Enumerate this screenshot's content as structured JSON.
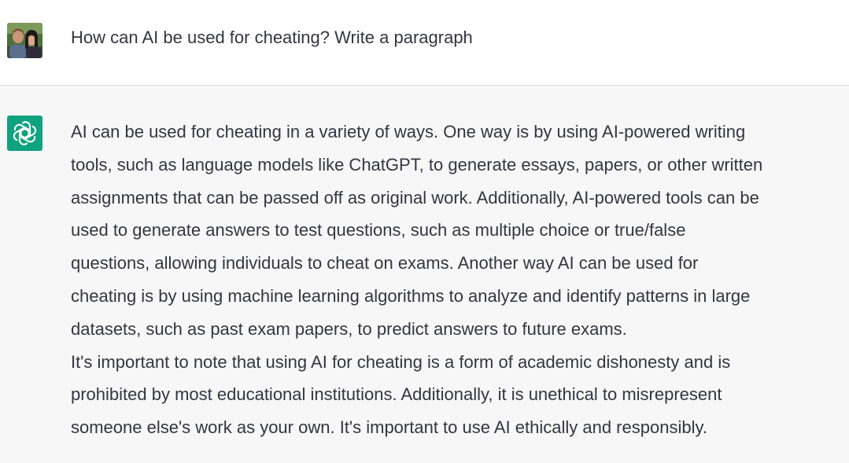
{
  "conversation": {
    "user_message": {
      "avatar_icon": "user-avatar-photo",
      "text": "How can AI be used for cheating?  Write a paragraph"
    },
    "assistant_message": {
      "logo_icon": "openai-logo-icon",
      "brand_color": "#10a37f",
      "paragraph1_lines": [
        "AI can be used for cheating in a variety of ways. One way is by using AI-powered writing",
        "tools, such as language models like ChatGPT, to generate essays, papers, or other written",
        "assignments that can be passed off as original work. Additionally, AI-powered tools can be",
        "used to generate answers to test questions, such as multiple choice or true/false",
        "questions, allowing individuals to cheat on exams. Another way AI can be used for",
        "cheating is by using machine learning algorithms to analyze and identify patterns in large",
        "datasets, such as past exam papers, to predict answers to future exams."
      ],
      "paragraph2_lines": [
        "It's important to note that using AI for cheating is a form of academic dishonesty and is",
        "prohibited by most educational institutions. Additionally, it is unethical to misrepresent",
        "someone else's work as your own. It's important to use AI ethically and responsibly."
      ]
    }
  }
}
